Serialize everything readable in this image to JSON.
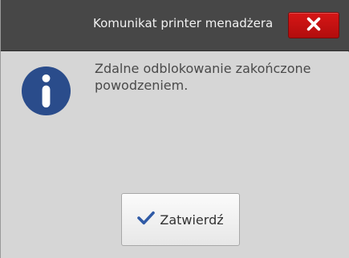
{
  "window": {
    "title": "Komunikat printer menadżera"
  },
  "icons": {
    "close": "close-icon",
    "info": "info-icon",
    "check": "check-icon"
  },
  "message": {
    "text": "Zdalne odblokowanie zakończone powodzeniem."
  },
  "buttons": {
    "confirm_label": "Zatwierdź"
  },
  "colors": {
    "titlebar_bg": "#474747",
    "close_red": "#c91111",
    "info_blue": "#2a4c8b",
    "check_blue": "#2f5aa6",
    "dialog_bg": "#d6d6d6"
  }
}
